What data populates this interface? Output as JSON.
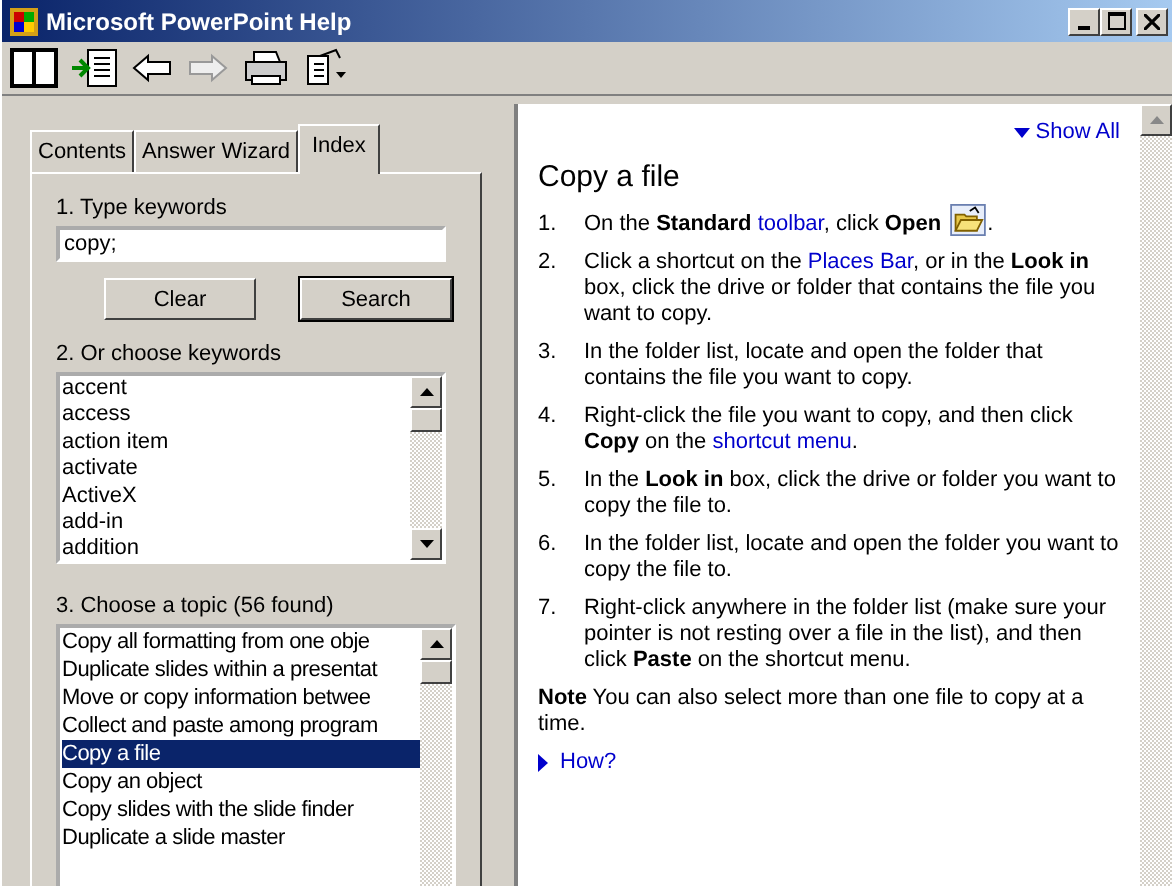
{
  "window": {
    "title": "Microsoft PowerPoint Help"
  },
  "tabs": [
    {
      "label": "Contents",
      "selected": false
    },
    {
      "label": "Answer Wizard",
      "selected": false
    },
    {
      "label": "Index",
      "selected": true
    }
  ],
  "step1": {
    "label": "1. Type keywords",
    "value": "copy;",
    "buttons": [
      "Clear",
      "Search"
    ]
  },
  "step2": {
    "label": "2. Or choose keywords",
    "items": [
      {
        "text": "accent",
        "selected": false
      },
      {
        "text": "access",
        "selected": false
      },
      {
        "text": "action item",
        "selected": false
      },
      {
        "text": "activate",
        "selected": false
      },
      {
        "text": "ActiveX",
        "selected": false
      },
      {
        "text": "add-in",
        "selected": false
      },
      {
        "text": "addition",
        "selected": false
      }
    ]
  },
  "step3": {
    "label": "3. Choose a topic (56 found)",
    "items": [
      {
        "text": "Copy all formatting from one obje",
        "selected": false
      },
      {
        "text": "Duplicate slides within a presentat",
        "selected": false
      },
      {
        "text": "Move or copy information betwee",
        "selected": false
      },
      {
        "text": "Collect and paste among program",
        "selected": false
      },
      {
        "text": "Copy a file",
        "selected": true
      },
      {
        "text": "Copy an object",
        "selected": false
      },
      {
        "text": "Copy slides with the slide finder",
        "selected": false
      },
      {
        "text": "Duplicate a slide master",
        "selected": false
      }
    ]
  },
  "article": {
    "show_all": "Show All",
    "title": "Copy a file",
    "steps": [
      {
        "number": "1.",
        "parts": [
          {
            "kind": "text",
            "text": "On the **Standard** "
          },
          {
            "kind": "link",
            "text": "toolbar"
          },
          {
            "kind": "text",
            "text": ", click **Open** "
          },
          {
            "kind": "icon"
          },
          {
            "kind": "text",
            "text": "."
          }
        ]
      },
      {
        "number": "2.",
        "parts": [
          {
            "kind": "text",
            "text": "Click a shortcut on the "
          },
          {
            "kind": "link",
            "text": "Places Bar"
          },
          {
            "kind": "text",
            "text": ", or in the **Look in** box, click the drive or folder that contains the file you want to copy."
          }
        ]
      },
      {
        "number": "3.",
        "parts": [
          {
            "kind": "text",
            "text": "In the folder list, locate and open the folder that contains the file you want to copy."
          }
        ]
      },
      {
        "number": "4.",
        "parts": [
          {
            "kind": "text",
            "text": "Right-click the file you want to copy, and then click **Copy** on the "
          },
          {
            "kind": "link",
            "text": "shortcut menu"
          },
          {
            "kind": "text",
            "text": "."
          }
        ]
      },
      {
        "number": "5.",
        "parts": [
          {
            "kind": "text",
            "text": "In the **Look in** box, click the drive or folder you want to copy the file to."
          }
        ]
      },
      {
        "number": "6.",
        "parts": [
          {
            "kind": "text",
            "text": "In the folder list, locate and open the folder you want to copy the file to."
          }
        ]
      },
      {
        "number": "7.",
        "parts": [
          {
            "kind": "text",
            "text": "Right-click anywhere in the folder list (make sure your pointer is not resting over a file in the list), and then click **Paste** on the shortcut menu."
          }
        ]
      }
    ],
    "note": "**Note**   You can also select more than one file to copy at a time.",
    "how": "How?"
  }
}
